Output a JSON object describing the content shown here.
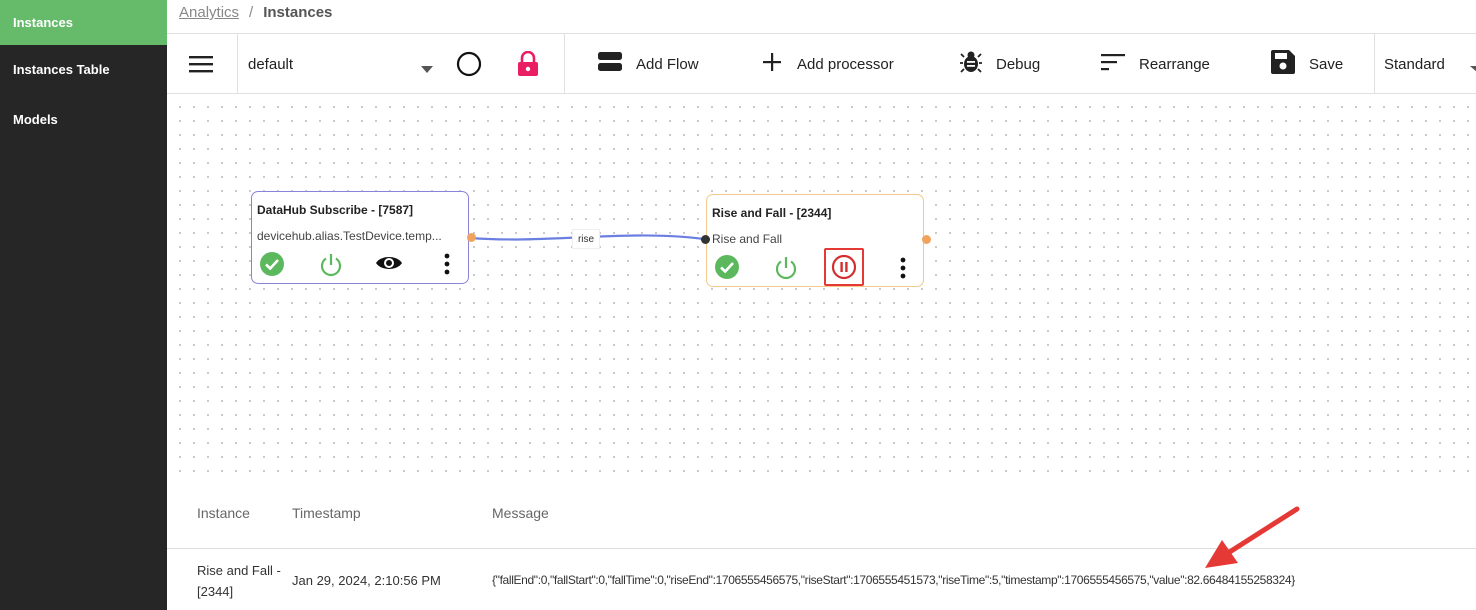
{
  "sidebar": {
    "items": [
      {
        "label": "Instances",
        "active": true
      },
      {
        "label": "Instances Table",
        "active": false
      },
      {
        "label": "Models",
        "active": false
      }
    ]
  },
  "breadcrumb": {
    "parent": "Analytics",
    "separator": "/",
    "current": "Instances"
  },
  "toolbar": {
    "flow_select_value": "default",
    "add_flow_label": "Add Flow",
    "add_processor_label": "Add processor",
    "debug_label": "Debug",
    "rearrange_label": "Rearrange",
    "save_label": "Save",
    "view_select_value": "Standard"
  },
  "nodes": {
    "subscribe": {
      "title": "DataHub Subscribe - [7587]",
      "subtitle": "devicehub.alias.TestDevice.temp..."
    },
    "rise_fall": {
      "title": "Rise and Fall - [2344]",
      "subtitle": "Rise and Fall"
    }
  },
  "edge": {
    "label": "rise"
  },
  "log": {
    "headers": {
      "instance": "Instance",
      "timestamp": "Timestamp",
      "message": "Message"
    },
    "rows": [
      {
        "instance_line1": "Rise and Fall -",
        "instance_line2": "[2344]",
        "timestamp": "Jan 29, 2024, 2:10:56 PM",
        "message": "{\"fallEnd\":0,\"fallStart\":0,\"fallTime\":0,\"riseEnd\":1706555456575,\"riseStart\":1706555451573,\"riseTime\":5,\"timestamp\":1706555456575,\"value\":82.66484155258324}"
      }
    ]
  },
  "colors": {
    "sidebar_bg": "#262626",
    "active_green": "#66bb6a",
    "lock_red": "#e91e63",
    "check_green": "#5cb85c",
    "pause_red": "#d32f2f",
    "edge_blue": "#6b7fe0",
    "port_orange": "#f0a35c",
    "annotation_red": "#e53935"
  }
}
